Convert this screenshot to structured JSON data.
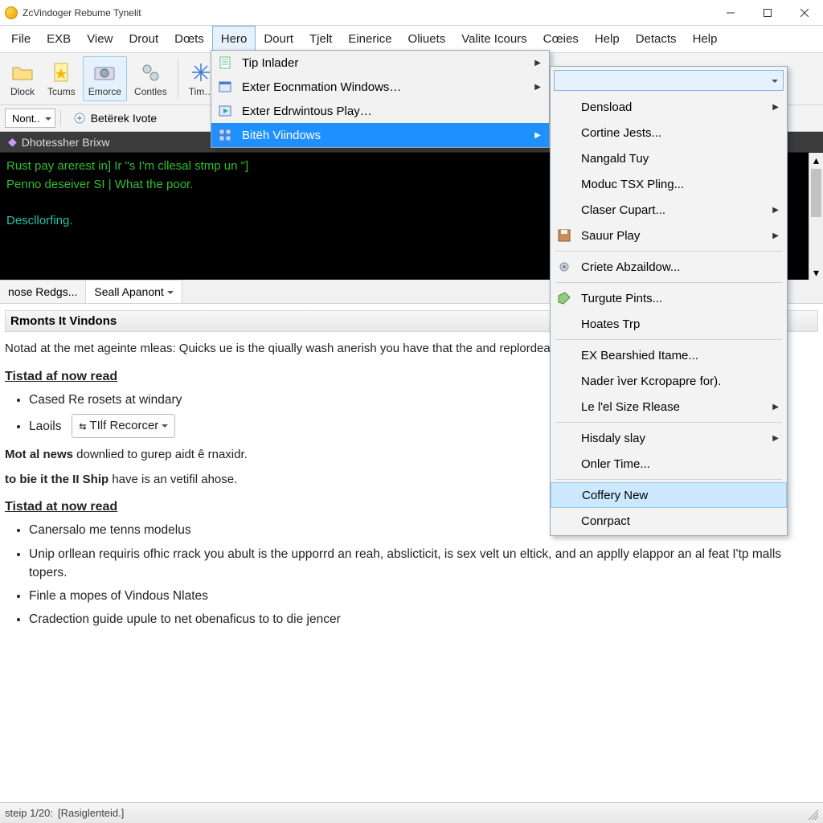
{
  "title": "ZcVindoger Rebume Tynelit",
  "menubar": [
    "File",
    "EXB",
    "View",
    "Drout",
    "Dœts",
    "Hero",
    "Dourt",
    "Tjelt",
    "Einerice",
    "Oliuets",
    "Valite Icours",
    "Cœies",
    "Help",
    "Detacts",
    "Help"
  ],
  "menubar_active_index": 5,
  "toolbar": [
    {
      "label": "Dlock",
      "icon": "folder"
    },
    {
      "label": "Tcums",
      "icon": "file-star"
    },
    {
      "label": "Emorce",
      "icon": "camera",
      "pressed": true
    },
    {
      "label": "Contles",
      "icon": "gears"
    },
    {
      "label": "Tim…",
      "icon": "sparkle"
    }
  ],
  "toolbar2": {
    "combo": "Nont..",
    "button": "Betërek Ivote"
  },
  "console": {
    "tab": "Dhotessher Brixw",
    "lines": [
      "Rust pay arerest in] Ir \"s I'm cllesal stmp un \"]",
      "Penno deseiver SI | What the poor.",
      "",
      "Descllorfing."
    ]
  },
  "tabs_under_console": [
    {
      "label": "nose Redgs...",
      "active": false
    },
    {
      "label": "Seall Apanont",
      "active": true,
      "chev": true
    }
  ],
  "doc": {
    "heading": "Rmonts It Vindons",
    "para1": "Notad at the met ageinte mleas: Quicks ue is the qiually wash anerish you have that the and replordea for you iotions of basep Thait.",
    "link1": "Tistad af now read",
    "bullets1": [
      "Cased Re rosets at windary",
      "Laoils"
    ],
    "inlinebtn": "TIlf Recorcer",
    "para2_strong": "Mot al news",
    "para2_rest": " downlied to gurep aidt ê rnaxidr.",
    "para3_strong": "to bie it the II Ship",
    "para3_rest": " have is an vetifil ahose.",
    "link2": "Tistad at now read",
    "bullets2": [
      "Canersalo me tenns modelus",
      "Unip orllean requiris ofhic rrack you abult is the upporrd an reah, abslicticit, is sex velt un eltick, and an applly elappor an al feat I'tp malls topers.",
      "Finle a mopes of Vindous Nlates",
      "Cradection guide upule to net obenaficus to to die jencer"
    ]
  },
  "dropdown": [
    {
      "label": "Tip Inlader",
      "icon": "doc",
      "arrow": true
    },
    {
      "label": "Exter Eocnmation Windows…",
      "icon": "win",
      "arrow": true
    },
    {
      "label": "Exter Edrwintous Play…",
      "icon": "play"
    },
    {
      "label": "Bitëh Viindows",
      "icon": "grid",
      "arrow": true,
      "highlight": true
    }
  ],
  "submenu": [
    {
      "label": "Densload",
      "arrow": true,
      "top": true
    },
    {
      "label": "Cortine Jests..."
    },
    {
      "label": "Nangald Tuy"
    },
    {
      "label": "Moduc TSX Pling..."
    },
    {
      "label": "Claser Cupart...",
      "arrow": true
    },
    {
      "label": "Sauur Play",
      "icon": "save",
      "arrow": true
    },
    {
      "sep": true
    },
    {
      "label": "Criete Abzaildow...",
      "icon": "gear"
    },
    {
      "sep": true
    },
    {
      "label": "Turgute Pints...",
      "icon": "tag"
    },
    {
      "label": "Hoates Trp"
    },
    {
      "sep": true
    },
    {
      "label": "EX Bearshied Itame..."
    },
    {
      "label": "Nader ìver Kcropapre for)."
    },
    {
      "label": "Le l'el Size Rlease",
      "arrow": true
    },
    {
      "sep": true
    },
    {
      "label": "Hisdaly slay",
      "arrow": true
    },
    {
      "label": "Onler Time..."
    },
    {
      "sep": true
    },
    {
      "label": "Coffery New",
      "highlight": true
    },
    {
      "label": "Conrpact"
    }
  ],
  "status": {
    "left": "steip 1/20:",
    "mid": "[Rasiglenteid.]"
  }
}
